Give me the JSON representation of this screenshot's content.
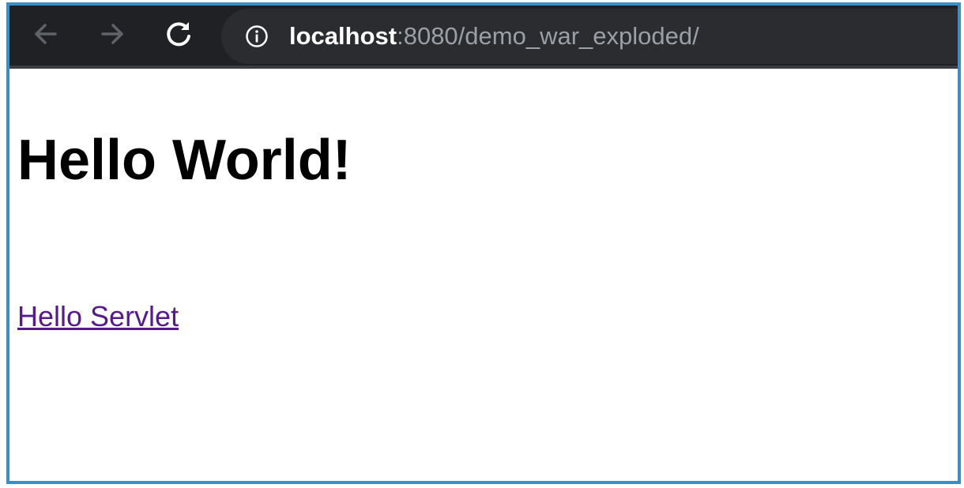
{
  "browser": {
    "address_bar": {
      "host": "localhost",
      "rest": ":8080/demo_war_exploded/"
    },
    "icons": {
      "back": "arrow-left-icon",
      "forward": "arrow-right-icon",
      "reload": "reload-icon",
      "info": "info-icon"
    }
  },
  "page": {
    "heading": "Hello World!",
    "link_label": "Hello Servlet"
  },
  "colors": {
    "toolbar_bg": "#202124",
    "omnibox_bg": "#2b2c2f",
    "frame_border": "#3a8fc4",
    "visited_link": "#551a8b"
  }
}
